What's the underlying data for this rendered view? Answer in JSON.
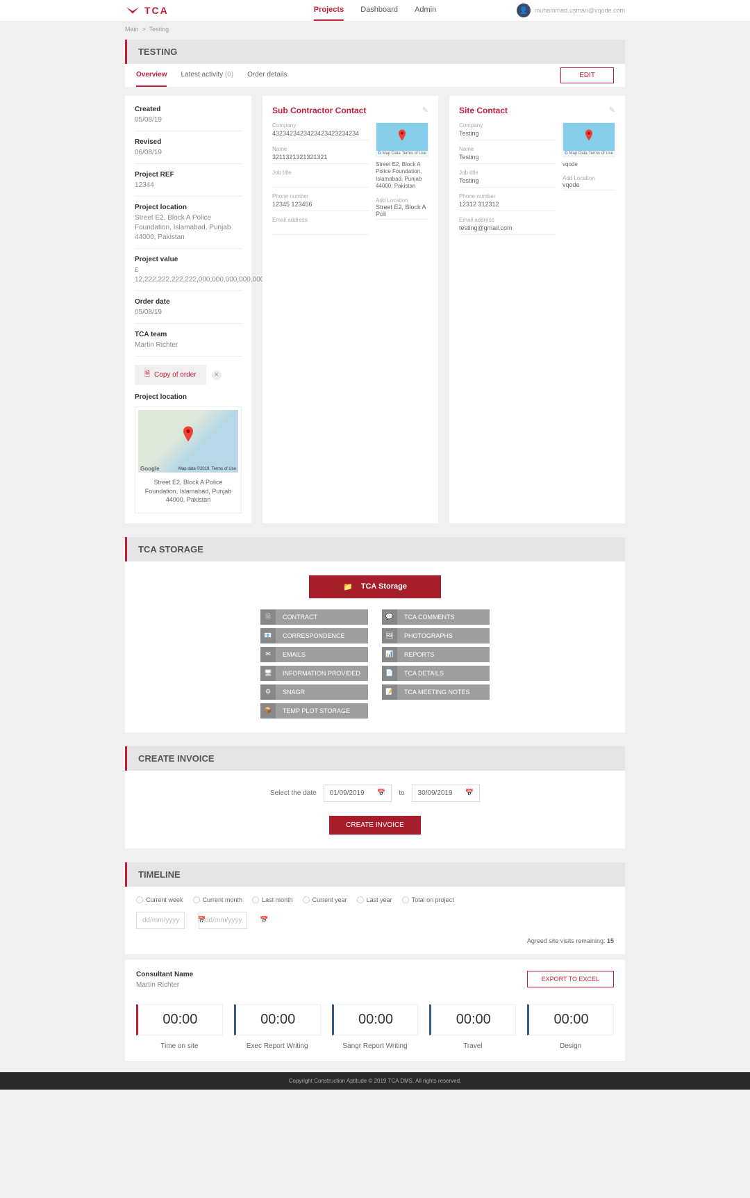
{
  "header": {
    "logo_text": "TCA",
    "nav": [
      "Projects",
      "Dashboard",
      "Admin"
    ],
    "username": "muhammad.usman@vqode.com"
  },
  "breadcrumb": {
    "main": "Main",
    "sep": ">",
    "current": "Testing"
  },
  "page_title": "TESTING",
  "tabs": {
    "overview": "Overview",
    "latest": "Latest activity",
    "latest_count": "(0)",
    "order": "Order details",
    "edit": "EDIT"
  },
  "meta": {
    "created_l": "Created",
    "created_v": "05/08/19",
    "revised_l": "Revised",
    "revised_v": "06/08/19",
    "ref_l": "Project REF",
    "ref_v": "12344",
    "loc_l": "Project location",
    "loc_v": "Street E2, Block A Police Foundation, Islamabad, Punjab 44000, Pakistan",
    "val_l": "Project value",
    "val_v": "£ 12,222,222,222,222,000,000,000,000,000",
    "date_l": "Order date",
    "date_v": "05/08/19",
    "team_l": "TCA team",
    "team_v": "Martin Richter"
  },
  "copy_order": "Copy of order",
  "map_section_label": "Project location",
  "map_caption": "Street E2, Block A Police Foundation, Islamabad, Punjab 44000, Pakistan",
  "map_data": "Map data ©2019",
  "map_terms": "Terms of Use",
  "subcon": {
    "title": "Sub Contractor Contact",
    "company_l": "Company",
    "company_v": "4323423423423423423234234",
    "name_l": "Name",
    "name_v": "3211321321321321",
    "job_l": "Job title",
    "job_v": "",
    "phone_l": "Phone number",
    "phone_v": "12345 123456",
    "email_l": "Email address",
    "email_v": "",
    "addloc_l": "Add Location",
    "addloc_v": "Street E2, Block A Poli",
    "map_addr": "Street E2, Block A Police Foundation, Islamabad, Punjab 44000, Pakistan"
  },
  "site": {
    "title": "Site Contact",
    "company_l": "Company",
    "company_v": "Testing",
    "name_l": "Name",
    "name_v": "Testing",
    "job_l": "Job title",
    "job_v": "Testing",
    "phone_l": "Phone number",
    "phone_v": "12312 312312",
    "email_l": "Email address",
    "email_v": "testing@gmail.com",
    "addloc_l": "Add Location",
    "addloc_v": "vqode",
    "map_addr": "vqode"
  },
  "mini_map": {
    "data": "Map Data",
    "terms": "Terms of Use"
  },
  "storage": {
    "title": "TCA STORAGE",
    "main_btn": "TCA Storage",
    "left": [
      "CONTRACT",
      "CORRESPONDENCE",
      "EMAILS",
      "INFORMATION PROVIDED",
      "SNAGR",
      "TEMP PLOT STORAGE"
    ],
    "right": [
      "TCA COMMENTS",
      "PHOTOGRAPHS",
      "REPORTS",
      "TCA DETAILS",
      "TCA MEETING NOTES"
    ]
  },
  "invoice": {
    "title": "CREATE INVOICE",
    "select_label": "Select the date",
    "from": "01/09/2019",
    "to_label": "to",
    "to": "30/09/2019",
    "btn": "CREATE INVOICE"
  },
  "timeline": {
    "title": "TIMELINE",
    "radios": [
      "Current week",
      "Current month",
      "Last month",
      "Current year",
      "Last year",
      "Total on project"
    ],
    "date_ph": "dd/mm/yyyy",
    "visits_label": "Agreed site visits remaining:",
    "visits_count": "15"
  },
  "consultant": {
    "label": "Consultant Name",
    "name": "Martin Richter",
    "export": "EXPORT TO EXCEL",
    "boxes": [
      {
        "val": "00:00",
        "label": "Time on site"
      },
      {
        "val": "00:00",
        "label": "Exec Report Writing"
      },
      {
        "val": "00:00",
        "label": "Sangr Report Writing"
      },
      {
        "val": "00:00",
        "label": "Travel"
      },
      {
        "val": "00:00",
        "label": "Design"
      }
    ]
  },
  "footer": "Copyright Construction Aptitude © 2019 TCA DMS. All rights reserved."
}
